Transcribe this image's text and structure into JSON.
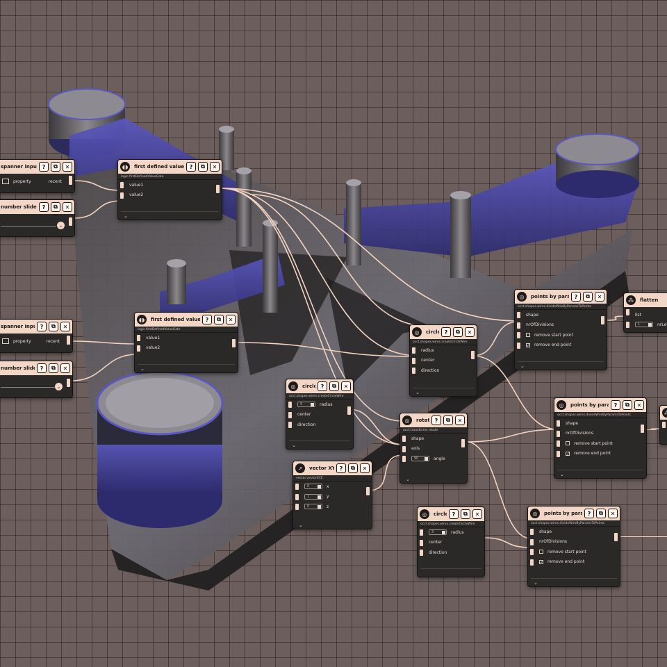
{
  "colors": {
    "background": "#6b5e5c",
    "grid": "#3d3333",
    "node_header": "#f2d7c6",
    "node_body": "#2b2828",
    "wire": "#f4d3c0",
    "model_band": "#4a48a8",
    "model_body": "#3a3838"
  },
  "buttons": {
    "help": "?",
    "duplicate": "⧉",
    "close": "✕",
    "expand": "⌄"
  },
  "nodes": {
    "spanner1": {
      "title": "spanner input value",
      "property_label": "property",
      "output_label": "recent"
    },
    "slider1": {
      "title": "number slider"
    },
    "gate1": {
      "title": "first defined value gate",
      "subtitle": "logic.firstDefinedValueGate",
      "inputs": [
        "value1",
        "value2"
      ]
    },
    "spanner2": {
      "title": "spanner input value",
      "property_label": "property",
      "output_label": "recent"
    },
    "slider2": {
      "title": "number slider"
    },
    "gate2": {
      "title": "first defined value gate",
      "subtitle": "logic.firstDefinedValueGate",
      "inputs": [
        "value1",
        "value2"
      ]
    },
    "circle1": {
      "title": "circle",
      "subtitle": "occt.shapes.wires.createCircleWire",
      "inputs": [
        "radius",
        "center",
        "direction"
      ]
    },
    "circle2": {
      "title": "circle",
      "subtitle": "occt.shapes.wires.createCircleWire",
      "radius_value": "5",
      "inputs": [
        "radius",
        "center",
        "direction"
      ]
    },
    "rotate": {
      "title": "rotate",
      "subtitle": "occt.transforms.rotate",
      "angle_value": "90",
      "inputs": [
        "shape",
        "axis",
        "angle"
      ]
    },
    "vector": {
      "title": "vector XYZ",
      "subtitle": "vector.vectorXYZ",
      "values": [
        "0",
        "1",
        "0"
      ],
      "inputs": [
        "x",
        "y",
        "z"
      ]
    },
    "circle3": {
      "title": "circle",
      "subtitle": "occt.shapes.wires.createCircleWire",
      "radius_value": "3",
      "inputs": [
        "radius",
        "center",
        "direction"
      ]
    },
    "points1": {
      "title": "points by params",
      "subtitle": "occt.shapes.wires.divideWireByParamsToPoints",
      "inputs": [
        "shape",
        "nrOfDivisions"
      ],
      "checks": [
        {
          "label": "remove start point",
          "checked": false
        },
        {
          "label": "remove end point",
          "checked": true
        }
      ]
    },
    "points2": {
      "title": "points by params",
      "subtitle": "occt.shapes.wires.divideWireByParamsToPoints",
      "inputs": [
        "shape",
        "nrOfDivisions"
      ],
      "checks": [
        {
          "label": "remove start point",
          "checked": false
        },
        {
          "label": "remove end point",
          "checked": true
        }
      ]
    },
    "points3": {
      "title": "points by params",
      "subtitle": "occt.shapes.wires.divideWireByParamsToPoints",
      "inputs": [
        "shape",
        "nrOfDivisions"
      ],
      "checks": [
        {
          "label": "remove start point",
          "checked": false
        },
        {
          "label": "remove end point",
          "checked": true
        }
      ]
    },
    "flatten": {
      "title": "flatten",
      "inputs": [
        "list",
        "nrLevels"
      ],
      "levels_value": "1"
    }
  }
}
